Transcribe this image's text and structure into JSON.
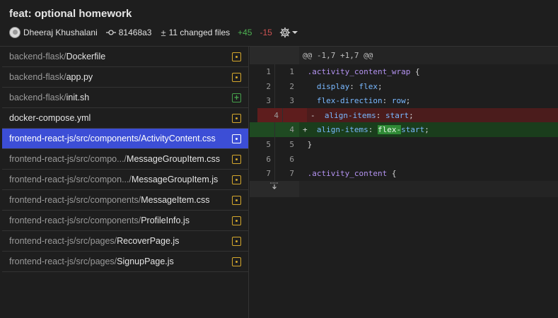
{
  "header": {
    "title": "feat: optional homework",
    "author": "Dheeraj Khushalani",
    "commit_sha": "81468a3",
    "changed_files": "11 changed files",
    "additions": "+45",
    "deletions": "-15"
  },
  "files": [
    {
      "dir": "backend-flask/",
      "name": "Dockerfile",
      "status": "modified"
    },
    {
      "dir": "backend-flask/",
      "name": "app.py",
      "status": "modified"
    },
    {
      "dir": "backend-flask/",
      "name": "init.sh",
      "status": "added"
    },
    {
      "dir": "",
      "name": "docker-compose.yml",
      "status": "modified"
    },
    {
      "dir": "frontend-react-js/src/components/",
      "name": "ActivityContent.css",
      "status": "modified",
      "selected": true
    },
    {
      "dir": "frontend-react-js/src/compo.../",
      "name": "MessageGroupItem.css",
      "status": "modified"
    },
    {
      "dir": "frontend-react-js/src/compon.../",
      "name": "MessageGroupItem.js",
      "status": "modified"
    },
    {
      "dir": "frontend-react-js/src/components/",
      "name": "MessageItem.css",
      "status": "modified"
    },
    {
      "dir": "frontend-react-js/src/components/",
      "name": "ProfileInfo.js",
      "status": "modified"
    },
    {
      "dir": "frontend-react-js/src/pages/",
      "name": "RecoverPage.js",
      "status": "modified"
    },
    {
      "dir": "frontend-react-js/src/pages/",
      "name": "SignupPage.js",
      "status": "modified"
    }
  ],
  "diff": {
    "hunk_header": "@@ -1,7 +1,7 @@",
    "lines": [
      {
        "old": "1",
        "new": "1",
        "type": "ctx",
        "prefix": " ",
        "code": ".activity_content_wrap {"
      },
      {
        "old": "2",
        "new": "2",
        "type": "ctx",
        "prefix": " ",
        "code": "  display: flex;"
      },
      {
        "old": "3",
        "new": "3",
        "type": "ctx",
        "prefix": " ",
        "code": "  flex-direction: row;"
      },
      {
        "old": "4",
        "new": "",
        "type": "del",
        "prefix": "-",
        "code": "  align-items: start;"
      },
      {
        "old": "",
        "new": "4",
        "type": "ins",
        "prefix": "+",
        "code": "  align-items: flex-start;"
      },
      {
        "old": "5",
        "new": "5",
        "type": "ctx",
        "prefix": " ",
        "code": "}"
      },
      {
        "old": "6",
        "new": "6",
        "type": "ctx",
        "prefix": " ",
        "code": ""
      },
      {
        "old": "7",
        "new": "7",
        "type": "ctx",
        "prefix": " ",
        "code": ".activity_content {"
      }
    ]
  },
  "colors": {
    "selected_row": "#3c4ed6",
    "modified_badge": "#d4a72c",
    "added_badge": "#46a14c",
    "additions": "#4eb052",
    "deletions": "#d05353"
  }
}
